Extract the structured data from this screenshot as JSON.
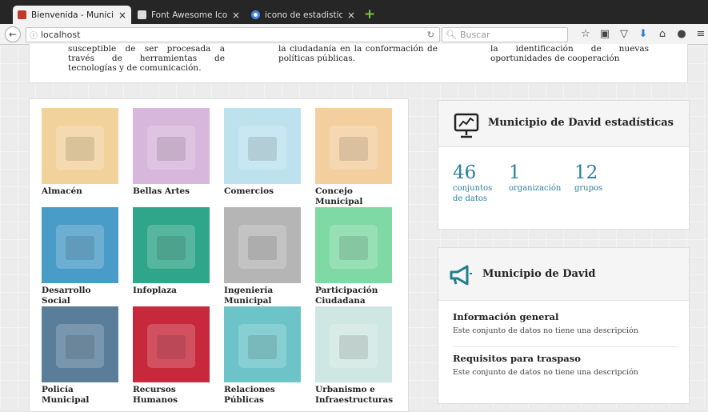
{
  "browser": {
    "tabs": [
      {
        "title": "Bienvenida - Municip...",
        "close": "×"
      },
      {
        "title": "Font Awesome Icons",
        "close": "×"
      },
      {
        "title": "icono de estadistica...",
        "close": "×"
      }
    ],
    "new_tab": "+",
    "url": "localhost",
    "search_placeholder": "Buscar"
  },
  "intro": {
    "col1": "susceptible de ser procesada a través de herramientas de tecnologías y de comunicación.",
    "col2": "la ciudadanía en la conformación de políticas públicas.",
    "col3": "la identificación de nuevas oportunidades de cooperación"
  },
  "groups": [
    {
      "label": "Almacén",
      "color": "#f2d29b"
    },
    {
      "label": "Bellas Artes",
      "color": "#d8b7dc"
    },
    {
      "label": "Comercios",
      "color": "#bde2ee"
    },
    {
      "label": "Concejo Municipal",
      "color": "#f3cfa0"
    },
    {
      "label": "Desarrollo Social",
      "color": "#4a9cc8"
    },
    {
      "label": "Infoplaza",
      "color": "#2fa58a"
    },
    {
      "label": "Ingeniería Municipal",
      "color": "#b5b5b5"
    },
    {
      "label": "Participación Ciudadana",
      "color": "#7fd9a4"
    },
    {
      "label": "Policía Municipal",
      "color": "#5a7e9a"
    },
    {
      "label": "Recursos Humanos",
      "color": "#c8283c"
    },
    {
      "label": "Relaciones Públicas",
      "color": "#6cc4c9"
    },
    {
      "label": "Urbanismo e Infraestructuras",
      "color": "#cfe7e2"
    }
  ],
  "stats": {
    "title": "Municipio de David estadísticas",
    "items": [
      {
        "value": "46",
        "label": "conjuntos de datos"
      },
      {
        "value": "1",
        "label": "organización"
      },
      {
        "value": "12",
        "label": "grupos"
      }
    ]
  },
  "org": {
    "title": "Municipio de David",
    "sections": [
      {
        "title": "Información general",
        "desc": "Este conjunto de datos no tiene una descripción"
      },
      {
        "title": "Requisitos para traspaso",
        "desc": "Este conjunto de datos no tiene una descripción"
      }
    ]
  }
}
